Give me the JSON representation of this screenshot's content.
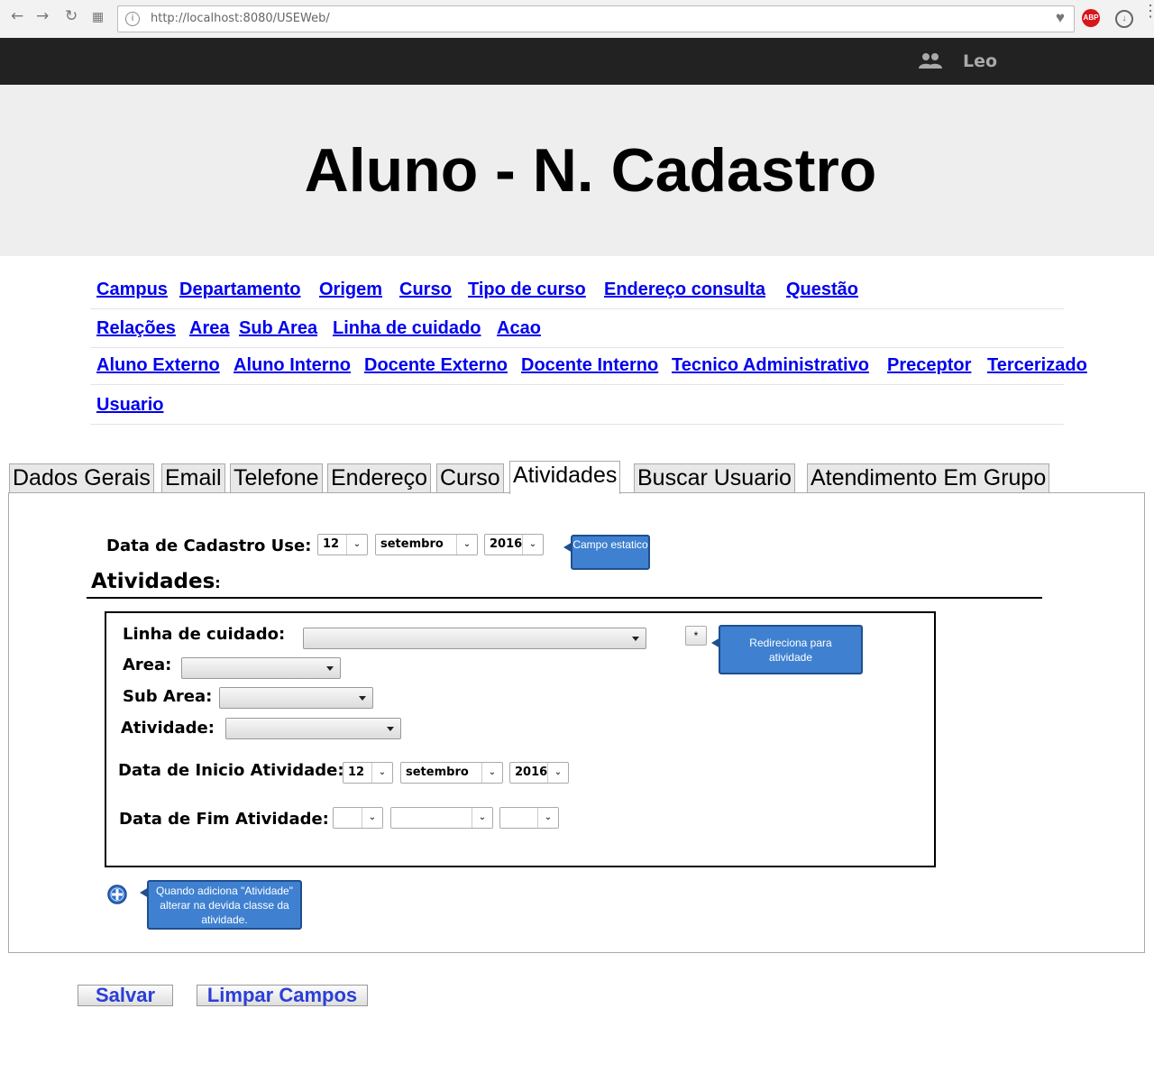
{
  "browser": {
    "url": "http://localhost:8080/USEWeb/"
  },
  "topbar": {
    "user_name": "Leo"
  },
  "header": {
    "title": "Aluno - N. Cadastro"
  },
  "nav": {
    "row1": [
      "Campus",
      "Departamento",
      "Origem",
      "Curso",
      "Tipo de curso",
      "Endereço consulta",
      "Questão"
    ],
    "row2": [
      "Relações",
      "Area",
      "Sub Area",
      "Linha de cuidado",
      "Acao"
    ],
    "row3": [
      "Aluno Externo",
      "Aluno Interno",
      "Docente Externo",
      "Docente Interno",
      "Tecnico Administrativo",
      "Preceptor",
      "Tercerizado"
    ],
    "row4": [
      "Usuario"
    ]
  },
  "tabs": [
    "Dados Gerais",
    "Email",
    "Telefone",
    "Endereço",
    "Curso",
    "Atividades",
    "Buscar Usuario",
    "Atendimento Em Grupo"
  ],
  "form": {
    "data_cadastro_label": "Data de Cadastro Use:",
    "data_cadastro": {
      "day": "12",
      "month": "setembro",
      "year": "2016"
    },
    "callout_static": "Campo estatico",
    "section_title": "Atividades",
    "section_colon": ":",
    "linha_label": "Linha de cuidado:",
    "area_label": "Area:",
    "subarea_label": "Sub Area:",
    "atividade_label": "Atividade:",
    "star_button": "*",
    "callout_redirect": "Redireciona para atividade",
    "inicio_label": "Data de Inicio Atividade:",
    "inicio": {
      "day": "12",
      "month": "setembro",
      "year": "2016"
    },
    "fim_label": "Data de Fim Atividade:",
    "callout_add": "Quando adiciona \"Atividade\" alterar na devida classe da atividade."
  },
  "buttons": {
    "save": "Salvar",
    "clear": "Limpar Campos"
  },
  "colors": {
    "link": "#0000ee",
    "callout": "#3f81d0",
    "topbar": "#222222"
  }
}
